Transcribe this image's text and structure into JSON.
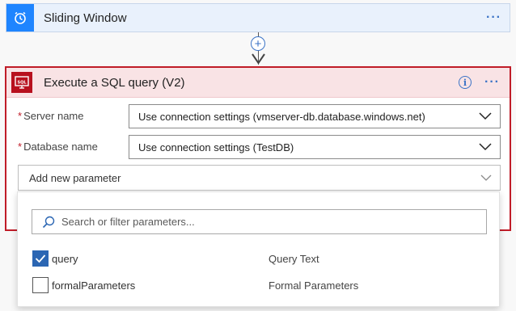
{
  "trigger": {
    "title": "Sliding Window",
    "icon": "alarm-clock-icon",
    "menu_label": "···",
    "accent": "#1f85ff"
  },
  "connector": {
    "add_label": "+"
  },
  "action": {
    "title": "Execute a SQL query (V2)",
    "icon": "sql-server-icon",
    "info_label": "i",
    "menu_label": "···",
    "border_color": "#c01c28",
    "header_color": "#f9e3e5",
    "fields": [
      {
        "required_mark": "*",
        "label": "Server name",
        "value": "Use connection settings (vmserver-db.database.windows.net)"
      },
      {
        "required_mark": "*",
        "label": "Database name",
        "value": "Use connection settings (TestDB)"
      }
    ],
    "add_parameter_label": "Add new parameter"
  },
  "parameter_panel": {
    "search_placeholder": "Search or filter parameters...",
    "items": [
      {
        "name": "query",
        "description": "Query Text",
        "checked": true
      },
      {
        "name": "formalParameters",
        "description": "Formal Parameters",
        "checked": false
      }
    ]
  }
}
